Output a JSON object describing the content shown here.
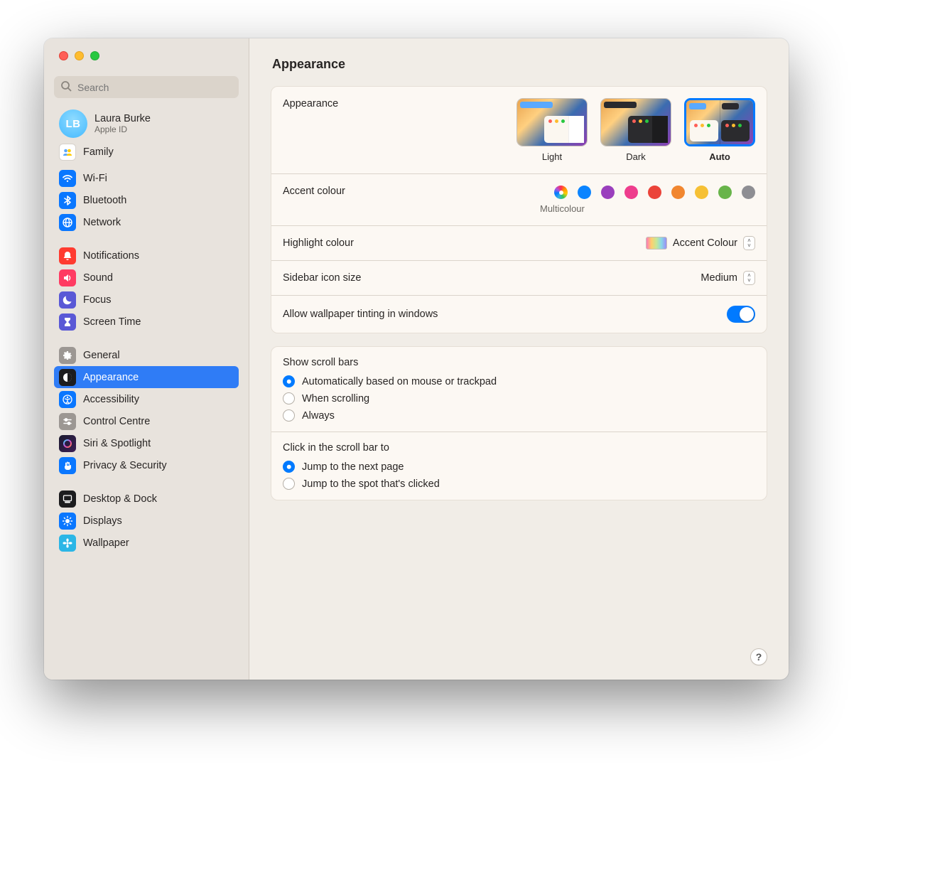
{
  "search": {
    "placeholder": "Search"
  },
  "account": {
    "initials": "LB",
    "name": "Laura Burke",
    "sub": "Apple ID"
  },
  "sidebar": {
    "sec0": [
      {
        "label": "Family",
        "bg": "#FFFFFF"
      }
    ],
    "sec1": [
      {
        "label": "Wi-Fi",
        "bg": "#0A77FF"
      },
      {
        "label": "Bluetooth",
        "bg": "#0A77FF"
      },
      {
        "label": "Network",
        "bg": "#0A77FF"
      }
    ],
    "sec2": [
      {
        "label": "Notifications",
        "bg": "#FF3B30"
      },
      {
        "label": "Sound",
        "bg": "#FF3B62"
      },
      {
        "label": "Focus",
        "bg": "#5A58D6"
      },
      {
        "label": "Screen Time",
        "bg": "#5A58D6"
      }
    ],
    "sec3": [
      {
        "label": "General",
        "bg": "#9C9793"
      },
      {
        "label": "Appearance",
        "bg": "#1C1C1E",
        "selected": true
      },
      {
        "label": "Accessibility",
        "bg": "#0A77FF"
      },
      {
        "label": "Control Centre",
        "bg": "#9C9793"
      },
      {
        "label": "Siri & Spotlight",
        "bg": "#1C1C1E"
      },
      {
        "label": "Privacy & Security",
        "bg": "#0A77FF"
      }
    ],
    "sec4": [
      {
        "label": "Desktop & Dock",
        "bg": "#1C1C1E"
      },
      {
        "label": "Displays",
        "bg": "#0A77FF"
      },
      {
        "label": "Wallpaper",
        "bg": "#2BB6E6"
      }
    ]
  },
  "page": {
    "title": "Appearance"
  },
  "appearance": {
    "label": "Appearance",
    "light": "Light",
    "dark": "Dark",
    "auto": "Auto",
    "selected": "Auto"
  },
  "accent": {
    "label": "Accent colour",
    "multicolour_label": "Multicolour",
    "colors": [
      "multi",
      "#0b84ff",
      "#9a3fbd",
      "#ee3d8d",
      "#eb4339",
      "#f1862f",
      "#f6c034",
      "#68b44a",
      "#8e8e93"
    ],
    "selected_index": 0
  },
  "highlight": {
    "label": "Highlight colour",
    "value": "Accent Colour"
  },
  "sidebar_size": {
    "label": "Sidebar icon size",
    "value": "Medium"
  },
  "tinting": {
    "label": "Allow wallpaper tinting in windows",
    "on": true
  },
  "scrollbars": {
    "title": "Show scroll bars",
    "options": [
      "Automatically based on mouse or trackpad",
      "When scrolling",
      "Always"
    ],
    "selected": 0
  },
  "scrollclick": {
    "title": "Click in the scroll bar to",
    "options": [
      "Jump to the next page",
      "Jump to the spot that's clicked"
    ],
    "selected": 0
  },
  "help": "?"
}
